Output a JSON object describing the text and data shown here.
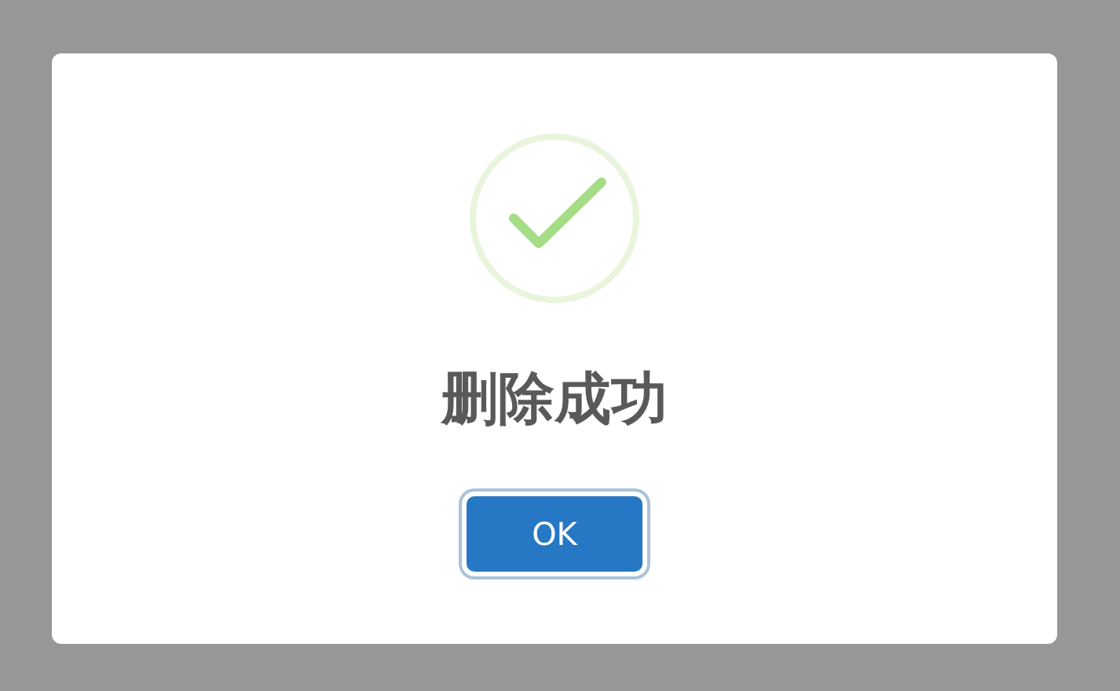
{
  "dialog": {
    "icon": {
      "kind": "success"
    },
    "title": "删除成功",
    "buttons": [
      {
        "label": "OK",
        "focused": true
      }
    ]
  }
}
